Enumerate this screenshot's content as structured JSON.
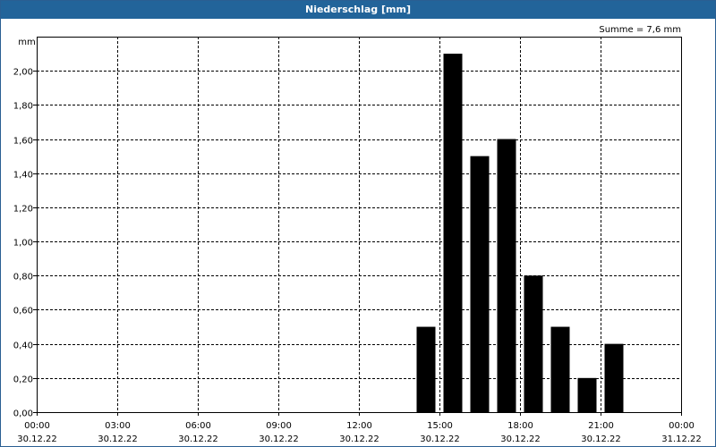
{
  "window": {
    "title": "Niederschlag [mm]"
  },
  "chart_data": {
    "type": "bar",
    "title": "Niederschlag [mm]",
    "ylabel": "mm",
    "summary": "Summe = 7,6 mm",
    "ylim": [
      0,
      2.2
    ],
    "y_ticks": [
      "0,00",
      "0,20",
      "0,40",
      "0,60",
      "0,80",
      "1,00",
      "1,20",
      "1,40",
      "1,60",
      "1,80",
      "2,00"
    ],
    "y_tick_values": [
      0,
      0.2,
      0.4,
      0.6,
      0.8,
      1.0,
      1.2,
      1.4,
      1.6,
      1.8,
      2.0
    ],
    "x_range_hours": [
      0,
      24
    ],
    "x_ticks": [
      {
        "hour": 0,
        "time": "00:00",
        "date": "30.12.22"
      },
      {
        "hour": 3,
        "time": "03:00",
        "date": "30.12.22"
      },
      {
        "hour": 6,
        "time": "06:00",
        "date": "30.12.22"
      },
      {
        "hour": 9,
        "time": "09:00",
        "date": "30.12.22"
      },
      {
        "hour": 12,
        "time": "12:00",
        "date": "30.12.22"
      },
      {
        "hour": 15,
        "time": "15:00",
        "date": "30.12.22"
      },
      {
        "hour": 18,
        "time": "18:00",
        "date": "30.12.22"
      },
      {
        "hour": 21,
        "time": "21:00",
        "date": "30.12.22"
      },
      {
        "hour": 24,
        "time": "00:00",
        "date": "31.12.22"
      }
    ],
    "bars": [
      {
        "hour": 14.5,
        "value": 0.5
      },
      {
        "hour": 15.5,
        "value": 2.1
      },
      {
        "hour": 16.5,
        "value": 1.5
      },
      {
        "hour": 17.5,
        "value": 1.6
      },
      {
        "hour": 18.5,
        "value": 0.8
      },
      {
        "hour": 19.5,
        "value": 0.5
      },
      {
        "hour": 20.5,
        "value": 0.2
      },
      {
        "hour": 21.5,
        "value": 0.4
      }
    ],
    "grid": true,
    "colors": {
      "bar": "#000000",
      "titlebar": "#22649a",
      "grid": "#000000"
    }
  }
}
